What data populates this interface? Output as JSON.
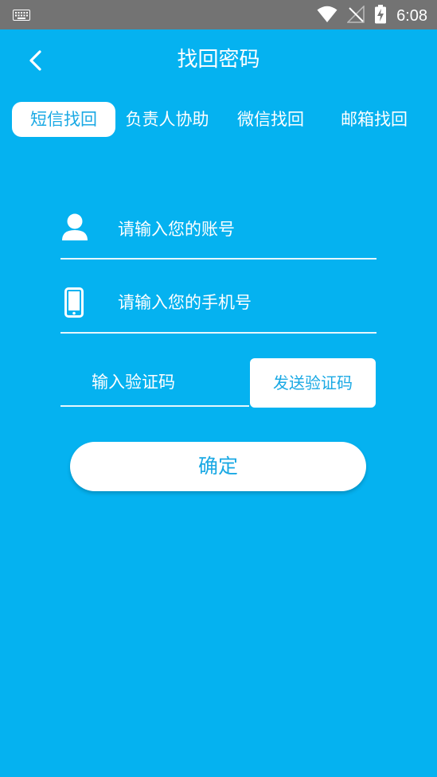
{
  "status_bar": {
    "time": "6:08",
    "icons": [
      "keyboard-icon",
      "wifi-icon",
      "no-signal-icon",
      "battery-charging-icon"
    ]
  },
  "header": {
    "title": "找回密码",
    "back_icon": "chevron-left-icon"
  },
  "tabs": [
    {
      "label": "短信找回",
      "active": true
    },
    {
      "label": "负责人协助",
      "active": false
    },
    {
      "label": "微信找回",
      "active": false
    },
    {
      "label": "邮箱找回",
      "active": false
    }
  ],
  "form": {
    "account": {
      "placeholder": "请输入您的账号",
      "value": "",
      "icon": "user-icon"
    },
    "phone": {
      "placeholder": "请输入您的手机号",
      "value": "",
      "icon": "phone-icon"
    },
    "code": {
      "placeholder": "输入验证码",
      "value": ""
    },
    "send_code_label": "发送验证码",
    "confirm_label": "确定"
  },
  "colors": {
    "background": "#05b2f0",
    "accent_text": "#1aa9e4",
    "status_bar": "#737373"
  }
}
